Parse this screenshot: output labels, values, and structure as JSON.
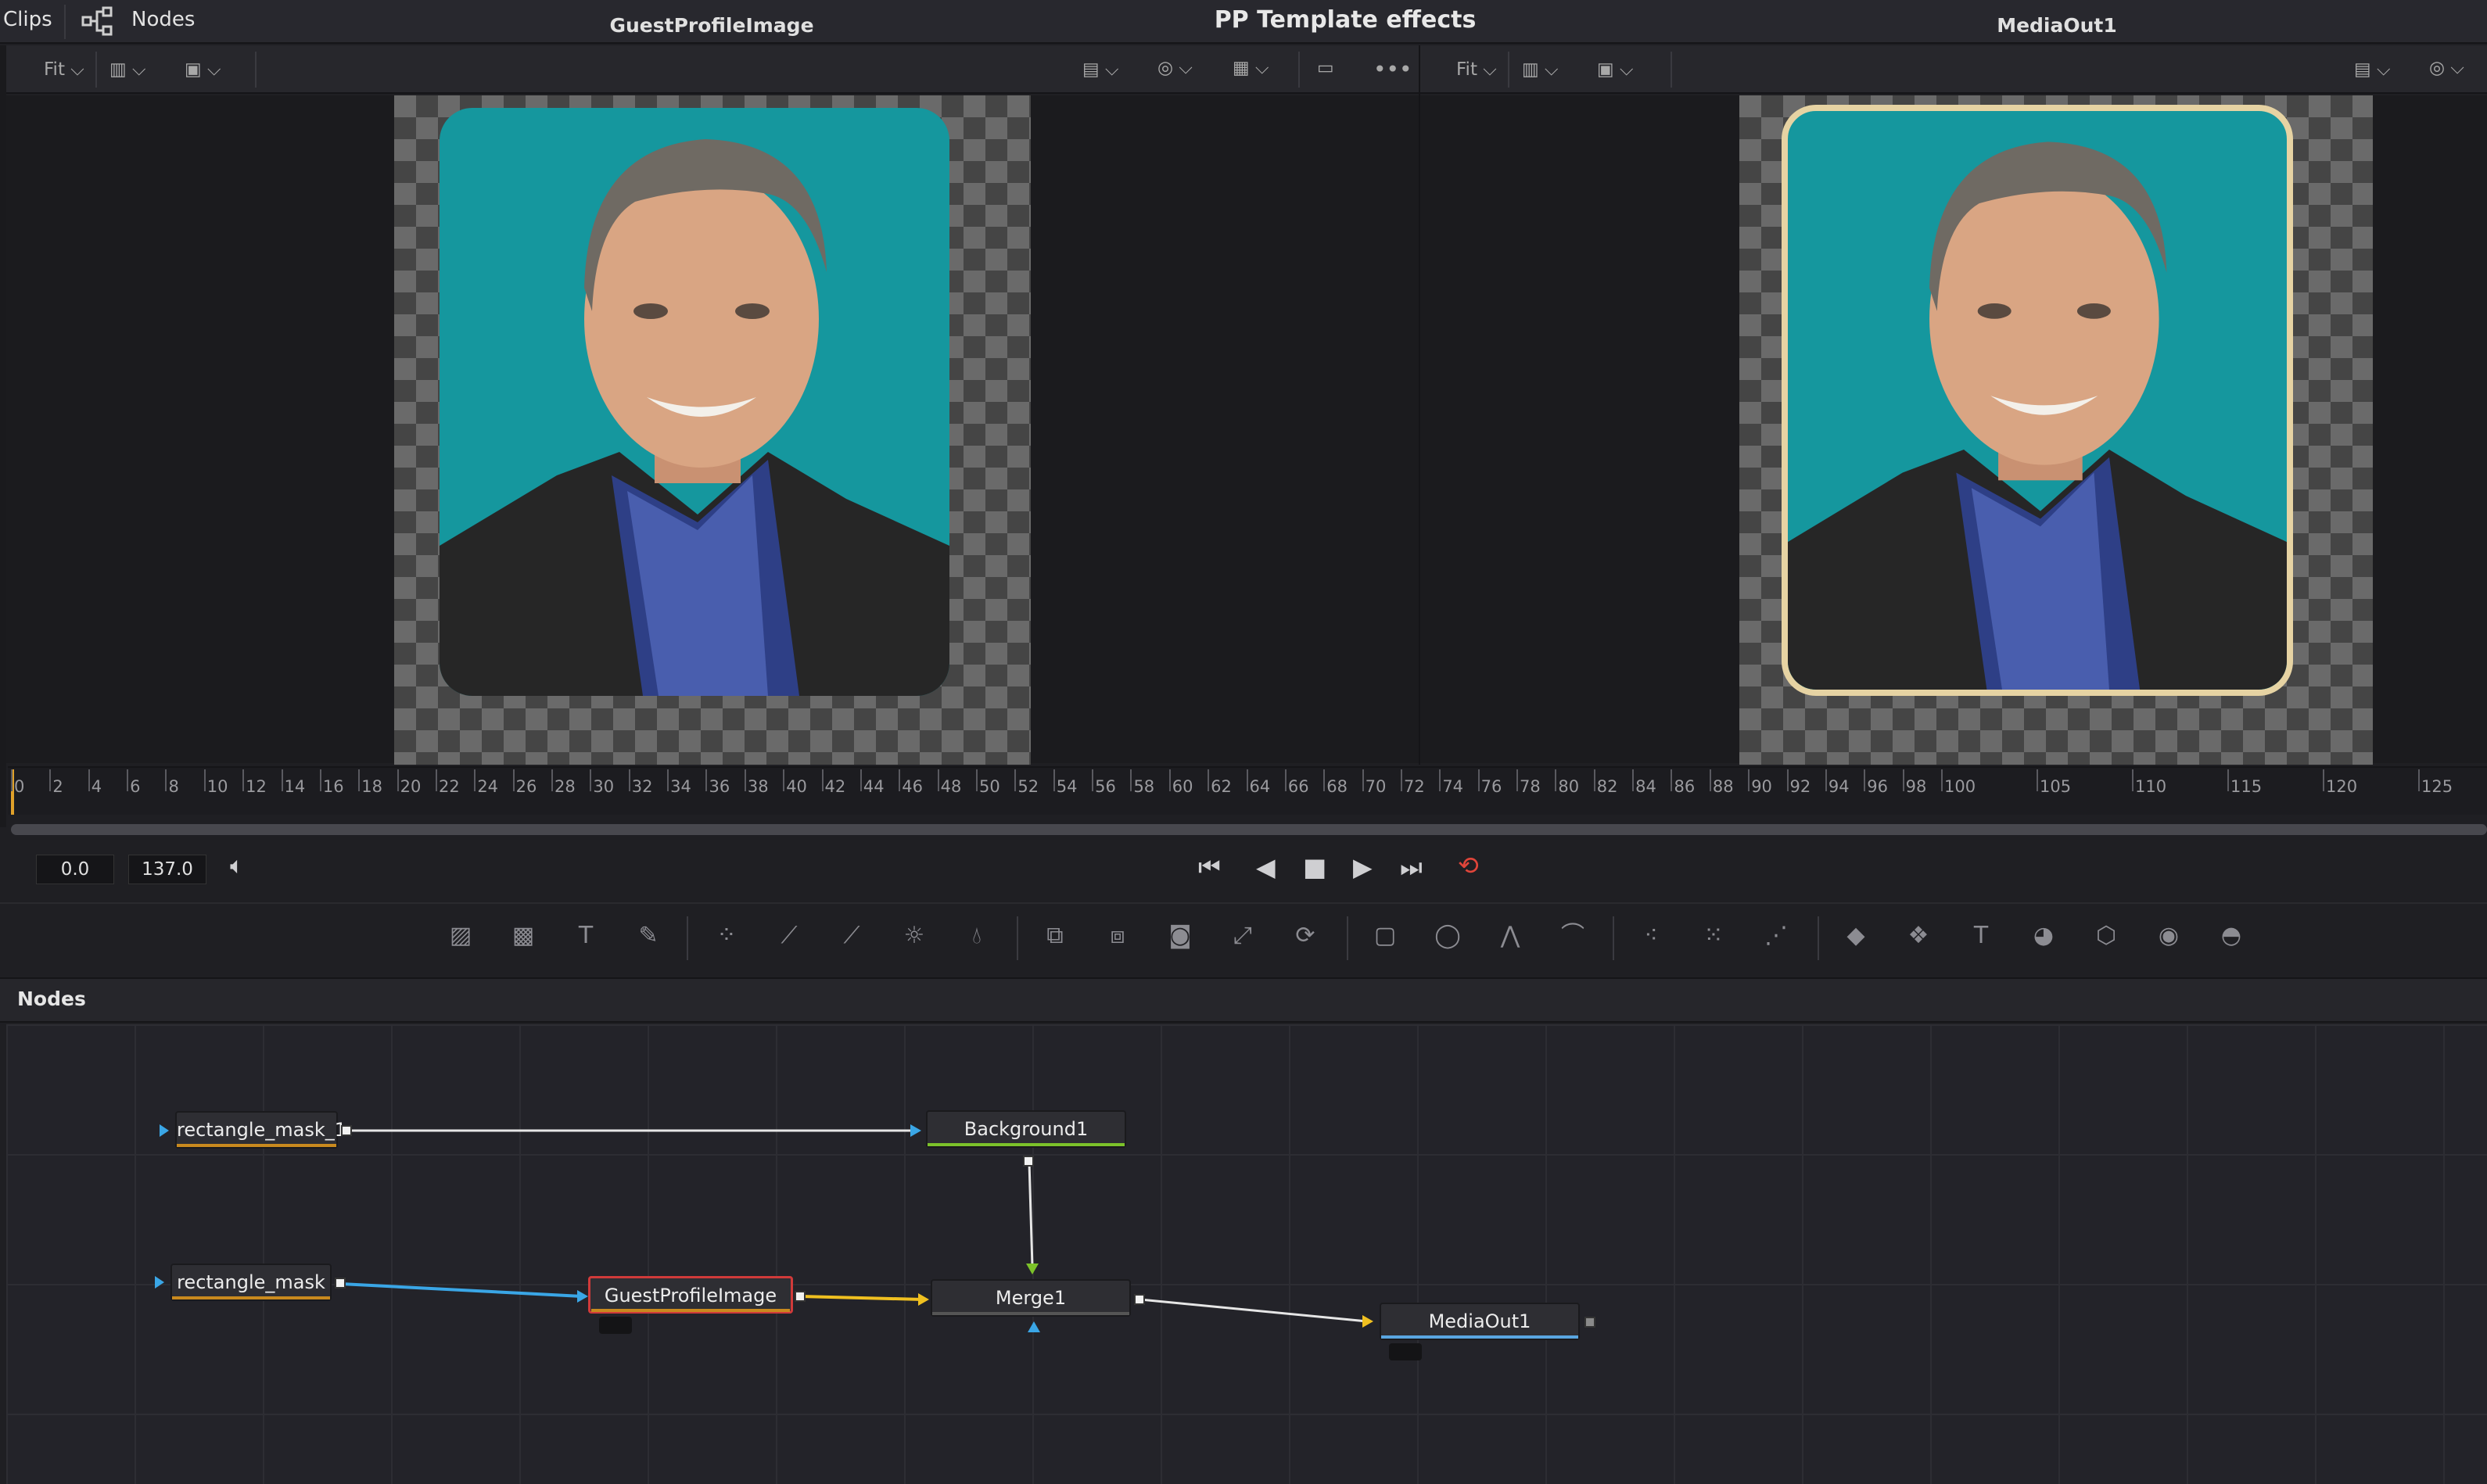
{
  "topbar": {
    "clips_label": "Clips",
    "nodes_label": "Nodes",
    "title": "PP Template effects"
  },
  "viewer_left": {
    "fit_label": "Fit",
    "title": "GuestProfileImage",
    "more": "•••"
  },
  "viewer_right": {
    "fit_label": "Fit",
    "title": "MediaOut1"
  },
  "ruler": {
    "labels": [
      "0",
      "2",
      "4",
      "6",
      "8",
      "10",
      "12",
      "14",
      "16",
      "18",
      "20",
      "22",
      "24",
      "26",
      "28",
      "30",
      "32",
      "34",
      "36",
      "38",
      "40",
      "42",
      "44",
      "46",
      "48",
      "50",
      "52",
      "54",
      "56",
      "58",
      "60",
      "62",
      "64",
      "66",
      "68",
      "70",
      "72",
      "74",
      "76",
      "78",
      "80",
      "82",
      "84",
      "86",
      "88",
      "90",
      "92",
      "94",
      "96",
      "98",
      "100",
      "105",
      "110",
      "115",
      "120",
      "125"
    ]
  },
  "transport": {
    "current_time": "0.0",
    "end_time": "137.0"
  },
  "nodes_panel": {
    "header": "Nodes",
    "nodes": {
      "rect1": "rectangle_mask_1",
      "rect": "rectangle_mask",
      "background": "Background1",
      "guest": "GuestProfileImage",
      "merge": "Merge1",
      "mediaout": "MediaOut1"
    }
  },
  "colors": {
    "accent_loop": "#e0453a",
    "guest_outline": "#d03a3a",
    "mask_underline": "#c98a1e",
    "background_underline": "#7cc22a",
    "media_underline": "#5aa6e0",
    "wire_blue": "#3aa6e6",
    "wire_yellow": "#f0c020"
  }
}
